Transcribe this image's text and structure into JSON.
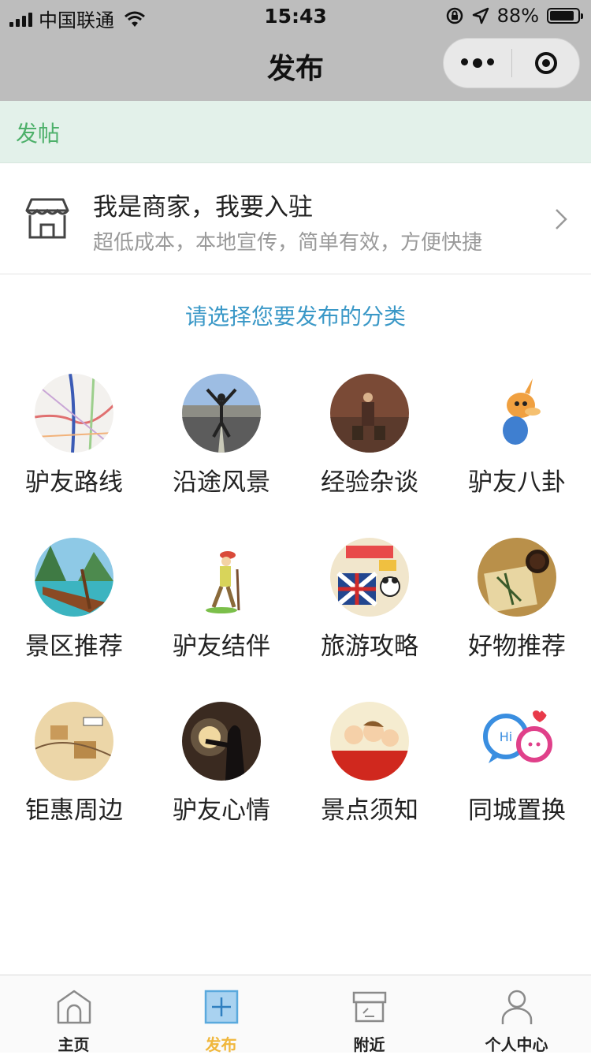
{
  "status_bar": {
    "carrier": "中国联通",
    "time": "15:43",
    "battery": "88%",
    "battery_level": 0.88
  },
  "nav": {
    "title": "发布"
  },
  "post_header": {
    "label": "发帖"
  },
  "merchant": {
    "title": "我是商家，我要入驻",
    "subtitle": "超低成本，本地宣传，简单有效，方便快捷"
  },
  "category_prompt": "请选择您要发布的分类",
  "categories": [
    {
      "label": "驴友路线",
      "icon": "route-map-image"
    },
    {
      "label": "沿途风景",
      "icon": "road-traveler-image"
    },
    {
      "label": "经验杂谈",
      "icon": "traveler-suitcases-image"
    },
    {
      "label": "驴友八卦",
      "icon": "cartoon-kangaroo-image"
    },
    {
      "label": "景区推荐",
      "icon": "longtail-boat-image"
    },
    {
      "label": "驴友结伴",
      "icon": "cartoon-hiker-image"
    },
    {
      "label": "旅游攻略",
      "icon": "travel-stickers-image"
    },
    {
      "label": "好物推荐",
      "icon": "coffee-notebook-image"
    },
    {
      "label": "钜惠周边",
      "icon": "illustrated-map-image"
    },
    {
      "label": "驴友心情",
      "icon": "sunset-silhouette-image"
    },
    {
      "label": "景点须知",
      "icon": "cartoon-friends-image"
    },
    {
      "label": "同城置换",
      "icon": "chat-bubbles-image"
    }
  ],
  "chat_bubble_text": "Hi",
  "tabs": [
    {
      "label": "主页",
      "icon": "home-icon"
    },
    {
      "label": "发布",
      "icon": "plus-square-icon",
      "active": true
    },
    {
      "label": "附近",
      "icon": "store-box-icon"
    },
    {
      "label": "个人中心",
      "icon": "person-icon"
    }
  ],
  "colors": {
    "bar_gray": "#bdbdbd",
    "post_header_bg": "#e3f1ea",
    "post_header_text": "#4db06a",
    "prompt_blue": "#3a98c7",
    "active_tab": "#f0b73c",
    "active_icon": "#5aa9dd"
  }
}
